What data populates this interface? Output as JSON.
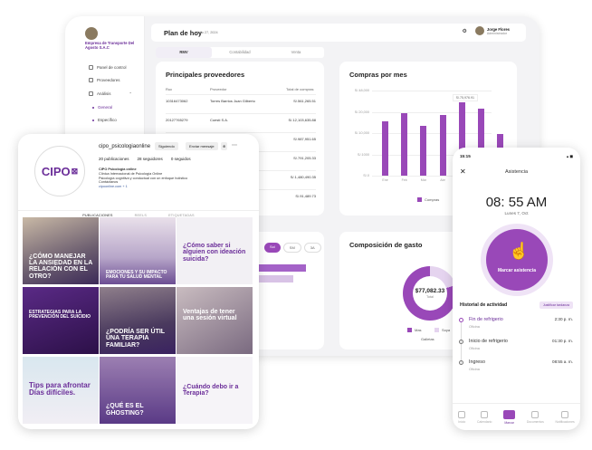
{
  "dashboard": {
    "company": "Empresa de Transporte Del Agosto S.A.C",
    "ruc": "",
    "nav": [
      {
        "label": "Panel de control",
        "icon": "grid-icon"
      },
      {
        "label": "Proveedores",
        "icon": "users-icon"
      },
      {
        "label": "Análisis",
        "icon": "chart-icon"
      },
      {
        "label": "General",
        "icon": "dot-icon"
      },
      {
        "label": "Específico",
        "icon": "dot-icon"
      }
    ],
    "title": "Plan de hoy",
    "date": "Julio 27, 2024",
    "user": {
      "name": "Jorge Flores",
      "role": "Administrador"
    },
    "tabs": [
      "RMV",
      "Contabilidad",
      "Venta"
    ],
    "suppliers": {
      "title": "Principales proveedores",
      "headers": [
        "Ruc",
        "Proveedor",
        "Total de compras"
      ],
      "rows": [
        {
          "ruc": "10316473062",
          "name": "Torres Barrios Juan Gilberto",
          "total": "S/.561,265.51"
        },
        {
          "ruc": "20127765279",
          "name": "Coesti S.A.",
          "total": "S/.12,103,635.88"
        },
        {
          "ruc": "",
          "name": "",
          "total": "S/.987,951.65"
        },
        {
          "ruc": "",
          "name": "",
          "total": "S/.791,205.33"
        },
        {
          "ruc": "",
          "name": "",
          "total": "S/.1,480,490.35"
        },
        {
          "ruc": "",
          "name": "",
          "total": "S/.91,489.73"
        }
      ]
    },
    "purchases": {
      "title": "Compras por mes",
      "legend": "Compras"
    },
    "expense": {
      "title": "Composición de gasto",
      "total": "$77,082.33",
      "total_label": "Total",
      "legend": [
        "Mas",
        "Soya",
        "Galletas"
      ]
    },
    "filters": [
      "Sol",
      "SM",
      "3A"
    ]
  },
  "chart_data": {
    "type": "bar",
    "categories": [
      "Ene",
      "Feb",
      "Mar",
      "Abr",
      "May",
      "Jun",
      "Jul"
    ],
    "series": [
      {
        "name": "Compras",
        "values": [
          2.55,
          2.95,
          2.35,
          2.85,
          3.45,
          3.15,
          1.95
        ]
      }
    ],
    "yticks": [
      "S/.0",
      "S/.1000",
      "S/.10,000",
      "S/.20,000",
      "S/.48,000"
    ],
    "ylim": [
      0,
      4
    ],
    "tooltip": "S/.75,976.91",
    "xlabel": "",
    "ylabel": ""
  },
  "instagram": {
    "username": "cipo_psicologiaonline",
    "logo": "CIPO",
    "follow_label": "Siguiendo",
    "message_label": "Enviar mensaje",
    "stats": [
      "20 publicaciones",
      "28 seguidores",
      "0 seguidos"
    ],
    "bio": [
      "CIPO Psicología online",
      "Clínica Internacional de Psicología Online",
      "Psicología cognitiva y conductual con un enfoque holístico",
      "Contáctanos",
      "cipoonline.com + 1"
    ],
    "tabs": [
      "PUBLICACIONES",
      "REELS",
      "ETIQUETADAS"
    ],
    "posts": [
      {
        "text": "¿CÓMO MANEJAR LA ANSIEDAD EN LA RELACIÓN CON EL OTRO?"
      },
      {
        "text": "EMOCIONES Y SU IMPACTO PARA TU SALUD MENTAL"
      },
      {
        "text": "¿Cómo saber si alguien con ideación suicida?"
      },
      {
        "text": "ESTRATEGIAS PARA LA PREVENCIÓN DEL SUICIDIO"
      },
      {
        "text": "¿PODRÍA SER ÚTIL UNA TERAPIA FAMILIAR?"
      },
      {
        "text": "Ventajas de tener una sesión virtual"
      },
      {
        "text": "Tips para afrontar Días difíciles."
      },
      {
        "text": "¿QUÉ ES EL GHOSTING?"
      },
      {
        "text": "¿Cuándo debo ir a Terapia?"
      }
    ]
  },
  "phone": {
    "status_time": "15:15",
    "screen_title": "Asistencia",
    "time": "08: 55 AM",
    "date": "Lunes 7, Oct",
    "mark_button": "Marcar asistencia",
    "history_title": "Historial de actividad",
    "history_badge": "Justificar tardanza",
    "history": [
      {
        "label": "Fin de refrigerio",
        "sub": "Oficina",
        "time": "2:30  p. m."
      },
      {
        "label": "Inicio de refrigerio",
        "sub": "Oficina",
        "time": "01:30  p. m."
      },
      {
        "label": "Ingreso",
        "sub": "Oficina",
        "time": "08:55  a. m."
      }
    ],
    "bottom_nav": [
      "Inicio",
      "Calendario",
      "Marcar",
      "Documentos",
      "Notificaciones"
    ]
  }
}
